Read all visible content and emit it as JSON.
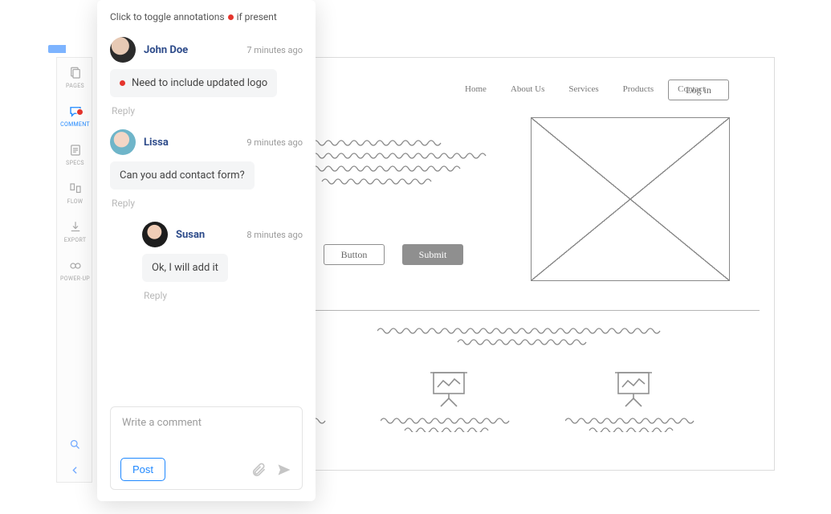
{
  "sidebar": {
    "items": [
      {
        "label": "PAGES"
      },
      {
        "label": "COMMENT"
      },
      {
        "label": "SPECS"
      },
      {
        "label": "FLOW"
      },
      {
        "label": "EXPORT"
      },
      {
        "label": "POWER-UP"
      }
    ]
  },
  "panel": {
    "note_pre": "Click to toggle annotations",
    "note_post": "if present",
    "reply_label": "Reply",
    "composer_placeholder": "Write a comment",
    "post_label": "Post",
    "comments": [
      {
        "author": "John Doe",
        "time": "7 minutes ago",
        "text": "Need to include updated logo",
        "has_marker": true
      },
      {
        "author": "Lissa",
        "time": "9 minutes ago",
        "text": "Can you add contact form?",
        "has_marker": false
      },
      {
        "author": "Susan",
        "time": "8 minutes ago",
        "text": "Ok, I will add it",
        "has_marker": false,
        "nested": true
      }
    ]
  },
  "wireframe": {
    "nav": [
      "Home",
      "About Us",
      "Services",
      "Products",
      "Contact"
    ],
    "login_label": "Log in",
    "button_outline": "Button",
    "button_filled": "Submit"
  }
}
